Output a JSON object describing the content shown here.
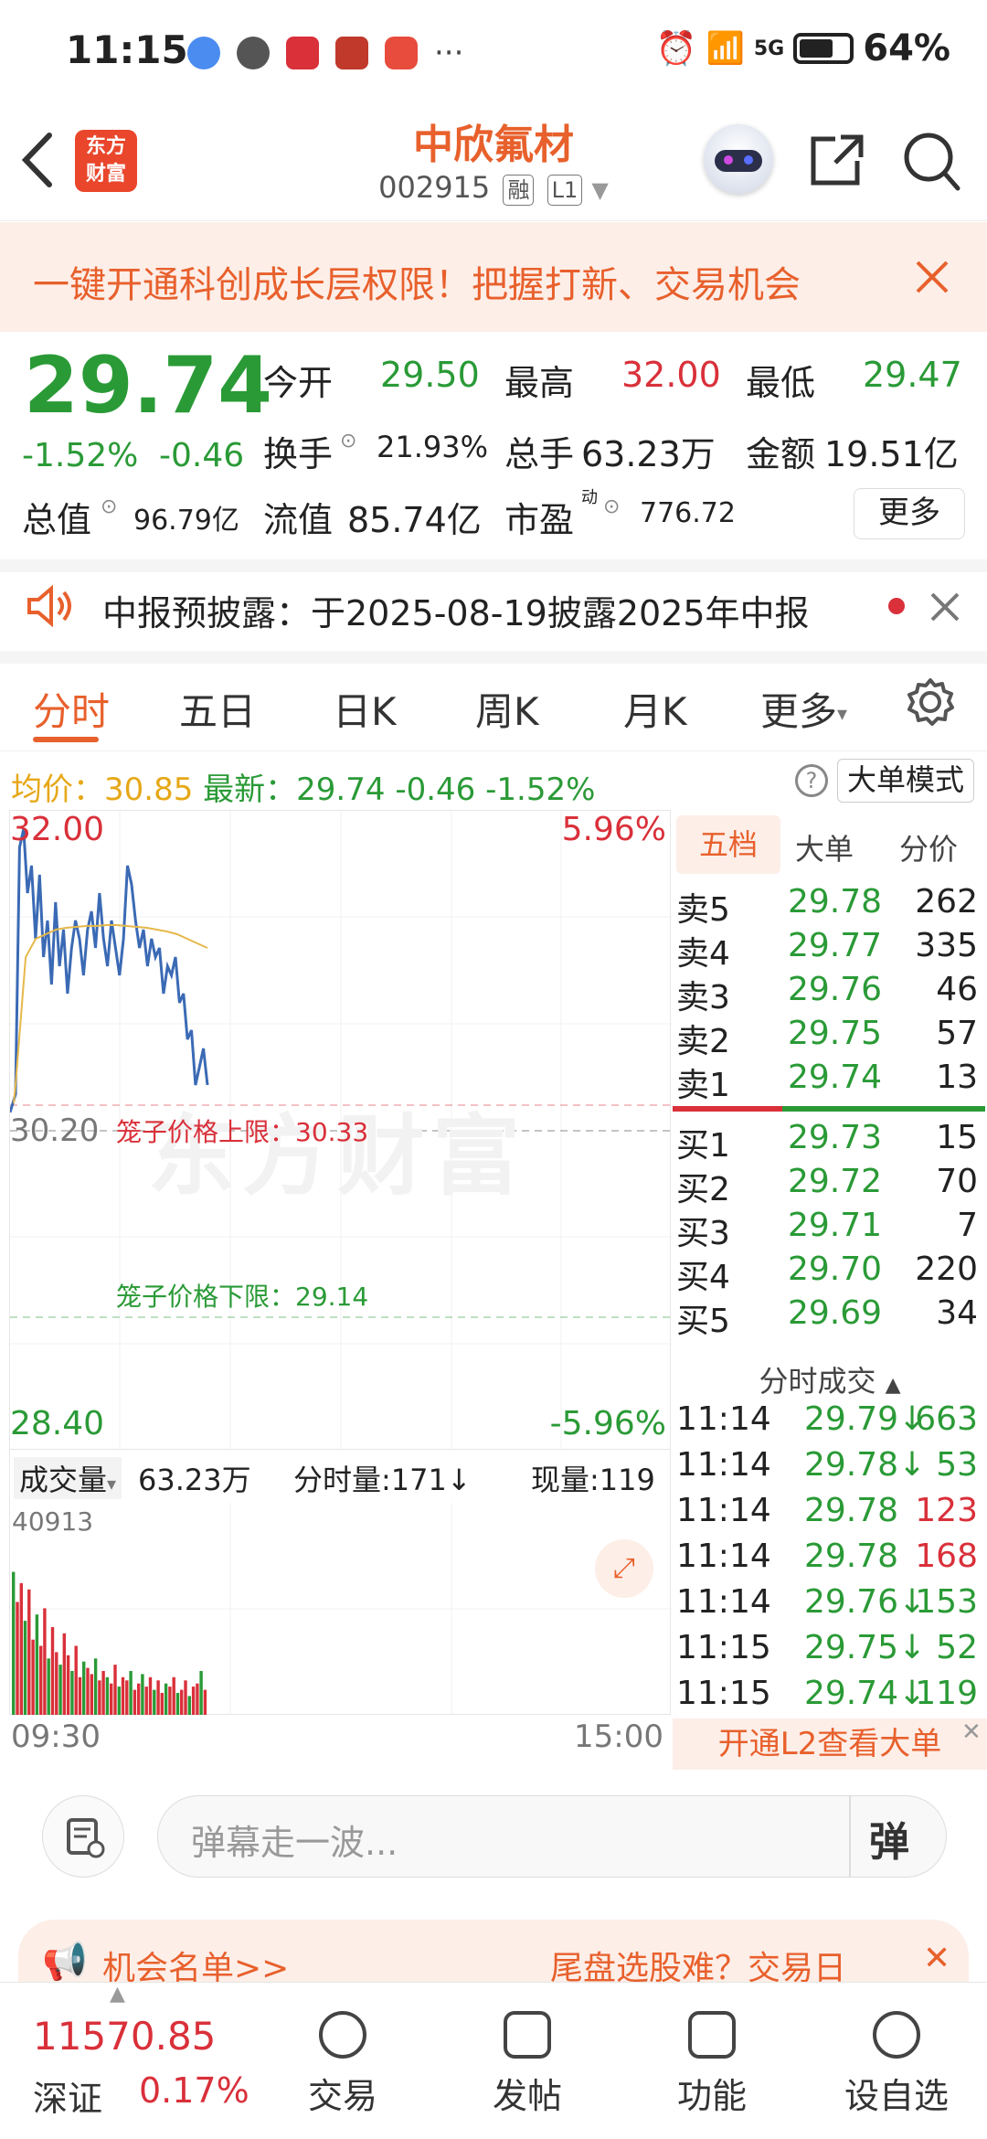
{
  "status_bar": {
    "time": "11:15",
    "network": "5G",
    "battery": "64%"
  },
  "header": {
    "back_icon": "back-arrow-icon",
    "logo_line1": "东方",
    "logo_line2": "财富",
    "title": "中欣氟材",
    "code": "002915",
    "tag1": "融",
    "tag2": "L1"
  },
  "banner": {
    "text": "一键开通科创成长层权限！把握打新、交易机会"
  },
  "quote": {
    "price": "29.74",
    "change_pct": "-1.52%",
    "change": "-0.46",
    "open_label": "今开",
    "open": "29.50",
    "high_label": "最高",
    "high": "32.00",
    "low_label": "最低",
    "low": "29.47",
    "turnover_label": "换手",
    "turnover": "21.93%",
    "volume_label": "总手",
    "volume": "63.23万",
    "amount_label": "金额",
    "amount": "19.51亿",
    "mktcap_label": "总值",
    "mktcap": "96.79亿",
    "float_label": "流值",
    "float_cap": "85.74亿",
    "pe_label": "市盈",
    "pe_sup": "动",
    "pe": "776.72",
    "more": "更多"
  },
  "notice": {
    "text": "中报预披露：于2025-08-19披露2025年中报"
  },
  "tabs": [
    "分时",
    "五日",
    "日K",
    "周K",
    "月K",
    "更多"
  ],
  "info_line": {
    "avg_label": "均价：",
    "avg": "30.85",
    "latest_label": "最新：",
    "latest": "29.74",
    "chg": "-0.46",
    "pct": "-1.52%",
    "big_order_mode": "大单模式"
  },
  "chart": {
    "top_price": "32.00",
    "top_pct": "5.96%",
    "mid_price": "30.20",
    "bottom_price": "28.40",
    "bottom_pct": "-5.96%",
    "upper_limit_label": "笼子价格上限：30.33",
    "lower_limit_label": "笼子价格下限：29.14",
    "watermark": "东方财富",
    "start_time": "09:30",
    "end_time": "15:00"
  },
  "volume": {
    "label": "成交量",
    "total": "63.23万",
    "minute_vol": "分时量:171↓",
    "current": "现量:119",
    "max": "40913"
  },
  "book_tabs": [
    "五档",
    "大单",
    "分价"
  ],
  "sells": [
    {
      "label": "卖5",
      "price": "29.78",
      "vol": "262"
    },
    {
      "label": "卖4",
      "price": "29.77",
      "vol": "335"
    },
    {
      "label": "卖3",
      "price": "29.76",
      "vol": "46"
    },
    {
      "label": "卖2",
      "price": "29.75",
      "vol": "57"
    },
    {
      "label": "卖1",
      "price": "29.74",
      "vol": "13"
    }
  ],
  "buys": [
    {
      "label": "买1",
      "price": "29.73",
      "vol": "15"
    },
    {
      "label": "买2",
      "price": "29.72",
      "vol": "70"
    },
    {
      "label": "买3",
      "price": "29.71",
      "vol": "7"
    },
    {
      "label": "买4",
      "price": "29.70",
      "vol": "220"
    },
    {
      "label": "买5",
      "price": "29.69",
      "vol": "34"
    }
  ],
  "trades_title": "分时成交",
  "trades": [
    {
      "time": "11:14",
      "price": "29.79↓",
      "vol": "663",
      "color": "green"
    },
    {
      "time": "11:14",
      "price": "29.78↓",
      "vol": "53",
      "color": "green"
    },
    {
      "time": "11:14",
      "price": "29.78",
      "vol": "123",
      "color": "red"
    },
    {
      "time": "11:14",
      "price": "29.78",
      "vol": "168",
      "color": "red"
    },
    {
      "time": "11:14",
      "price": "29.76↓",
      "vol": "153",
      "color": "green"
    },
    {
      "time": "11:15",
      "price": "29.75↓",
      "vol": "52",
      "color": "green"
    },
    {
      "time": "11:15",
      "price": "29.74↓",
      "vol": "119",
      "color": "green"
    }
  ],
  "l2_promo": "开通L2查看大单",
  "comment": {
    "placeholder": "弹幕走一波...",
    "send": "弹"
  },
  "opportunity": {
    "left": "机会名单>>",
    "right": "尾盘选股难？交易日"
  },
  "bottom_nav": {
    "index_value": "11570.85",
    "index_name": "深证",
    "index_pct": "0.17%",
    "items": [
      "交易",
      "发帖",
      "功能",
      "设自选"
    ]
  }
}
